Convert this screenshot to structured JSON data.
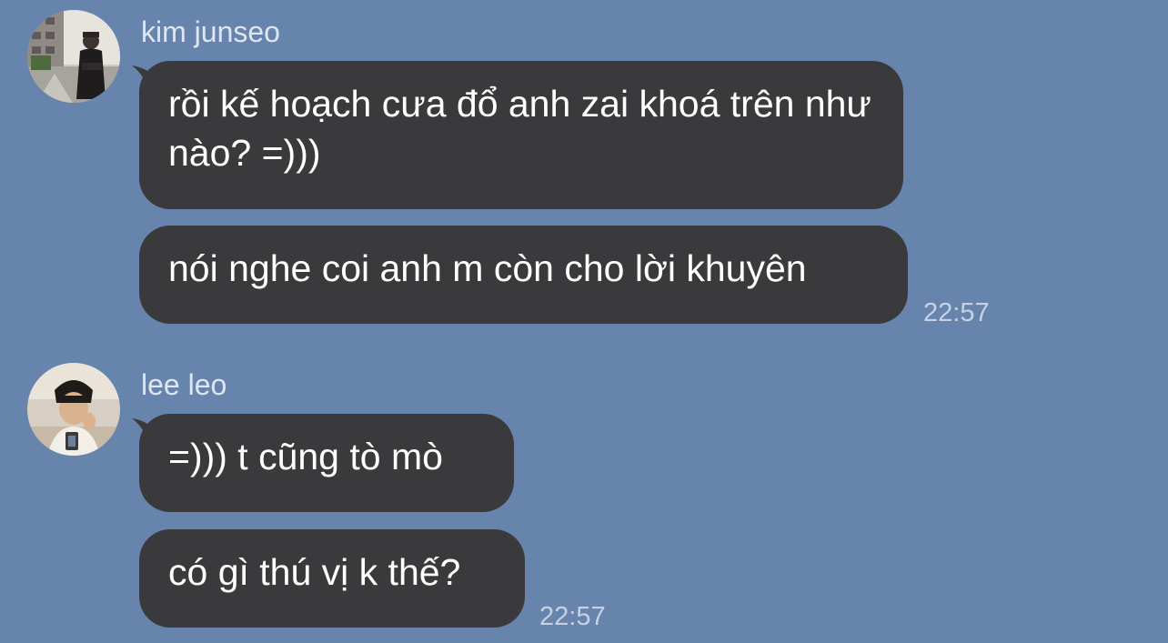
{
  "messages": [
    {
      "sender": "kim junseo",
      "avatar": "kim-junseo-avatar",
      "bubbles": [
        "rồi kế hoạch cưa đổ anh zai khoá trên như nào? =)))",
        "nói nghe coi anh m còn cho lời khuyên"
      ],
      "time": "22:57"
    },
    {
      "sender": "lee leo",
      "avatar": "lee-leo-avatar",
      "bubbles": [
        "=))) t cũng tò mò",
        "có gì thú vị k thế?"
      ],
      "time": "22:57"
    }
  ],
  "colors": {
    "background": "#6784ad",
    "bubble": "#3a3a3c",
    "bubble_text": "#ffffff",
    "meta_text": "#c6d2e4"
  }
}
